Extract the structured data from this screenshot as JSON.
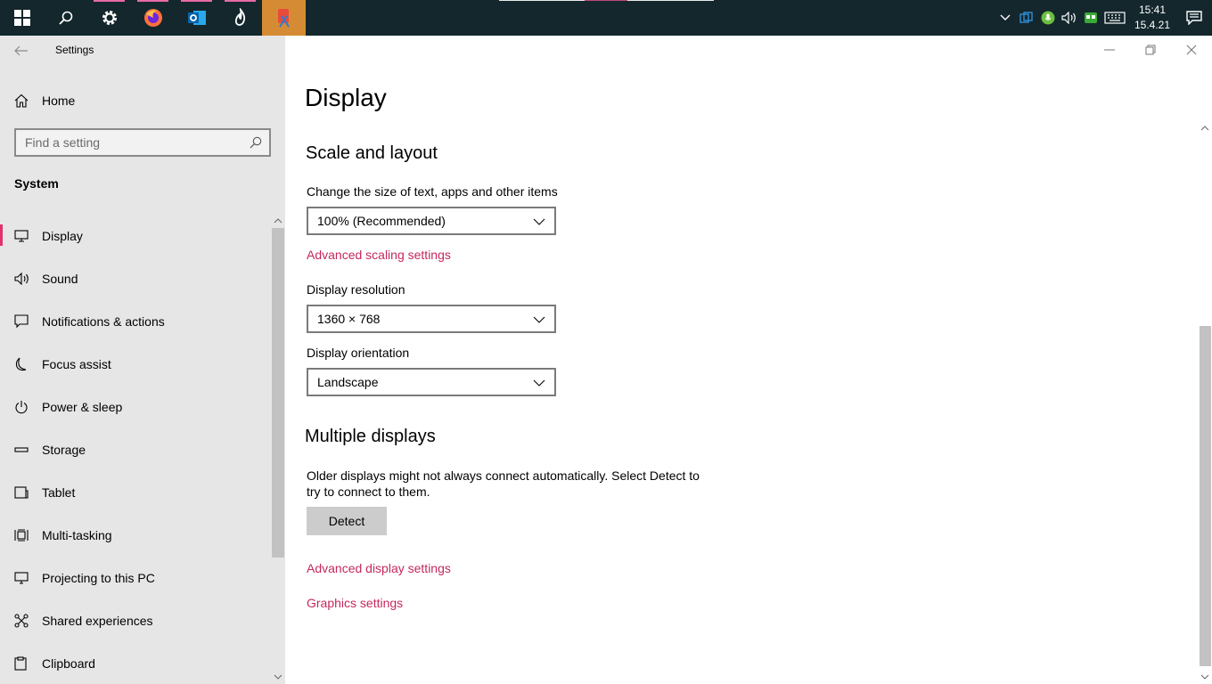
{
  "taskbar": {
    "clock_time": "15:41",
    "clock_date": "15.4.21"
  },
  "window": {
    "title": "Settings"
  },
  "sidebar": {
    "home_label": "Home",
    "search_placeholder": "Find a setting",
    "section_title": "System",
    "items": [
      {
        "label": "Display",
        "icon": "monitor-icon",
        "selected": true
      },
      {
        "label": "Sound",
        "icon": "speaker-icon"
      },
      {
        "label": "Notifications & actions",
        "icon": "notification-icon"
      },
      {
        "label": "Focus assist",
        "icon": "moon-icon"
      },
      {
        "label": "Power & sleep",
        "icon": "power-icon"
      },
      {
        "label": "Storage",
        "icon": "storage-icon"
      },
      {
        "label": "Tablet",
        "icon": "tablet-icon"
      },
      {
        "label": "Multi-tasking",
        "icon": "multitasking-icon"
      },
      {
        "label": "Projecting to this PC",
        "icon": "projecting-icon"
      },
      {
        "label": "Shared experiences",
        "icon": "shared-icon"
      },
      {
        "label": "Clipboard",
        "icon": "clipboard-icon"
      }
    ]
  },
  "main": {
    "page_title": "Display",
    "scale_section": {
      "heading": "Scale and layout",
      "scale_label": "Change the size of text, apps and other items",
      "scale_value": "100% (Recommended)",
      "advanced_scaling_link": "Advanced scaling settings",
      "resolution_label": "Display resolution",
      "resolution_value": "1360 × 768",
      "orientation_label": "Display orientation",
      "orientation_value": "Landscape"
    },
    "multiple_section": {
      "heading": "Multiple displays",
      "description": "Older displays might not always connect automatically. Select Detect to try to connect to them.",
      "detect_button": "Detect",
      "advanced_display_link": "Advanced display settings",
      "graphics_link": "Graphics settings"
    }
  },
  "colors": {
    "accent": "#c4285d",
    "selection_bar": "#e3306f",
    "taskbar": "#13272d"
  }
}
